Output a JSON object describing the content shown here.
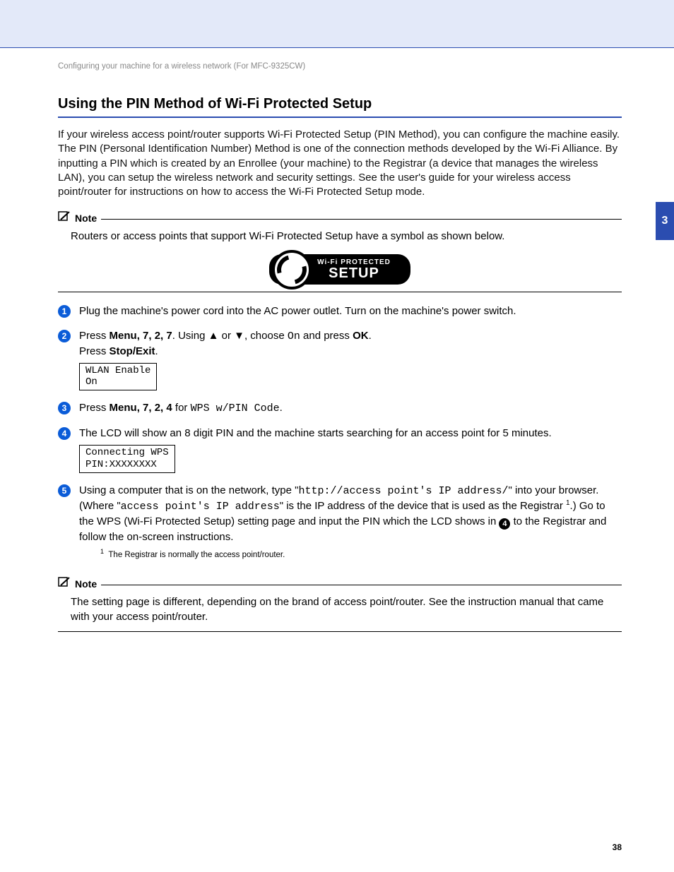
{
  "breadcrumb": "Configuring your machine for a wireless network (For MFC-9325CW)",
  "side_tab": "3",
  "heading": "Using the PIN Method of Wi-Fi Protected Setup",
  "intro": "If your wireless access point/router supports Wi-Fi Protected Setup (PIN Method), you can configure the machine easily. The PIN (Personal Identification Number) Method is one of the connection methods developed by the Wi-Fi Alliance. By inputting a PIN which is created by an Enrollee (your machine) to the Registrar (a device that manages the wireless LAN), you can setup the wireless network and security settings. See the user's guide for your wireless access point/router for instructions on how to access the Wi-Fi Protected Setup mode.",
  "note1": {
    "label": "Note",
    "text": "Routers or access points that support Wi-Fi Protected Setup have a symbol as shown below."
  },
  "wps": {
    "line1": "Wi-Fi PROTECTED",
    "line2": "SETUP"
  },
  "steps": {
    "s1": "Plug the machine's power cord into the AC power outlet. Turn on the machine's power switch.",
    "s2": {
      "pre": "Press ",
      "menu": "Menu",
      "seq": ", 7, 2, 7",
      "mid": ". Using ▲ or ▼, choose ",
      "on": "On",
      "post": " and press ",
      "ok": "OK",
      "end": ".",
      "line2a": "Press ",
      "stopexit": "Stop/Exit",
      "line2b": ".",
      "lcd": "WLAN Enable\nOn"
    },
    "s3": {
      "pre": "Press ",
      "menu": "Menu",
      "seq": ", 7, 2, 4",
      "mid": " for ",
      "code": "WPS w/PIN Code",
      "end": "."
    },
    "s4": {
      "text": "The LCD will show an 8 digit PIN and the machine starts searching for an access point for 5 minutes.",
      "lcd": "Connecting WPS\nPIN:XXXXXXXX"
    },
    "s5": {
      "a": "Using a computer that is on the network, type \"",
      "url": "http://access point's IP address/",
      "b": "\" into your browser. (Where \"",
      "ip": "access point's IP address",
      "c": "\" is the IP address of the device that is used as the Registrar ",
      "sup": "1",
      "d": ".) Go to the WPS (Wi-Fi Protected Setup) setting page and input the PIN which the LCD shows in ",
      "ref": "4",
      "e": " to the Registrar and follow the on-screen instructions."
    }
  },
  "footnote": {
    "num": "1",
    "text": "The Registrar is normally the access point/router."
  },
  "note2": {
    "label": "Note",
    "text": "The setting page is different, depending on the brand of access point/router. See the instruction manual that came with your access point/router."
  },
  "page_number": "38"
}
